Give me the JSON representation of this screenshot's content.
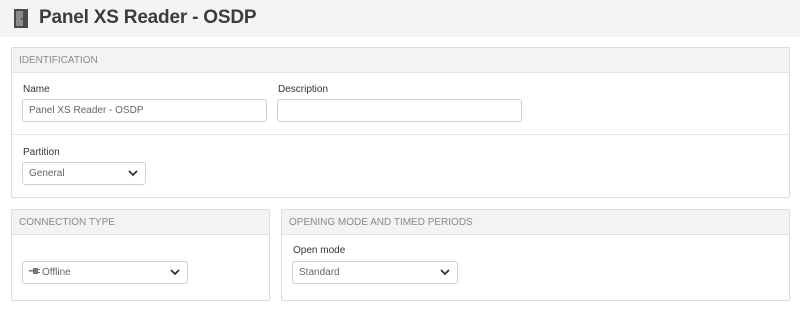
{
  "header": {
    "title": "Panel XS Reader - OSDP",
    "icon": "door-icon"
  },
  "identification": {
    "heading": "IDENTIFICATION",
    "name_label": "Name",
    "name_value": "Panel XS Reader - OSDP",
    "description_label": "Description",
    "description_value": "",
    "partition_label": "Partition",
    "partition_value": "General"
  },
  "connection": {
    "heading": "CONNECTION TYPE",
    "value": "Offline",
    "value_icon": "plug-icon"
  },
  "opening": {
    "heading": "OPENING MODE AND TIMED PERIODS",
    "open_mode_label": "Open mode",
    "open_mode_value": "Standard"
  }
}
